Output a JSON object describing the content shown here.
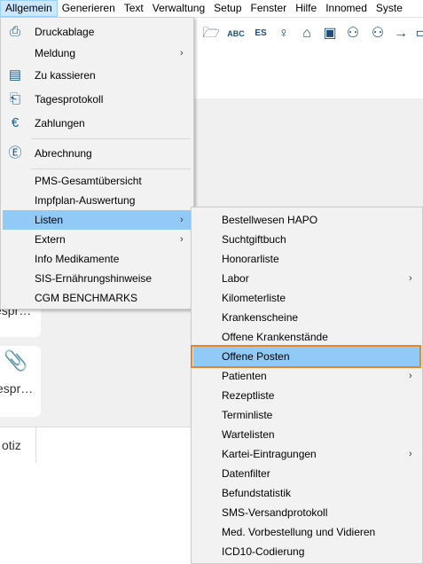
{
  "menubar": {
    "items": [
      "Allgemein",
      "Generieren",
      "Text",
      "Verwaltung",
      "Setup",
      "Fenster",
      "Hilfe",
      "Innomed",
      "Syste"
    ]
  },
  "toolbar": {
    "icons": [
      "folder-c-icon",
      "abc-document-icon",
      "es-document-icon",
      "person-key-icon",
      "house-person-icon",
      "id-card-icon",
      "person-arrows-icon",
      "person-add-icon",
      "person-arrow-icon",
      "clipboard-icon"
    ]
  },
  "background": {
    "card1_text": "espr…",
    "card2_text": "espr…",
    "notiz_label": "otiz"
  },
  "menu_allgemein": {
    "items": [
      {
        "label": "Druckablage",
        "icon": "printer-icon"
      },
      {
        "label": "Meldung",
        "icon": "",
        "submenu": true
      },
      {
        "label": "Zu kassieren",
        "icon": "cash-register-icon"
      },
      {
        "label": "Tagesprotokoll",
        "icon": "document-icon"
      },
      {
        "label": "Zahlungen",
        "icon": "euro-list-icon"
      },
      {
        "label": "Abrechnung",
        "icon": "euro-circle-icon"
      },
      {
        "label": "PMS-Gesamtübersicht",
        "icon": ""
      },
      {
        "label": "Impfplan-Auswertung",
        "icon": ""
      },
      {
        "label": "Listen",
        "icon": "",
        "submenu": true,
        "highlighted": true
      },
      {
        "label": "Extern",
        "icon": "",
        "submenu": true
      },
      {
        "label": "Info Medikamente",
        "icon": ""
      },
      {
        "label": "SIS-Ernährungshinweise",
        "icon": ""
      },
      {
        "label": "CGM BENCHMARKS",
        "icon": ""
      }
    ]
  },
  "menu_listen": {
    "items": [
      {
        "label": "Bestellwesen HAPO"
      },
      {
        "label": "Suchtgiftbuch"
      },
      {
        "label": "Honorarliste"
      },
      {
        "label": "Labor",
        "submenu": true
      },
      {
        "label": "Kilometerliste"
      },
      {
        "label": "Krankenscheine"
      },
      {
        "label": "Offene Krankenstände"
      },
      {
        "label": "Offene Posten",
        "highlighted": true
      },
      {
        "label": "Patienten",
        "submenu": true
      },
      {
        "label": "Rezeptliste"
      },
      {
        "label": "Terminliste"
      },
      {
        "label": "Wartelisten"
      },
      {
        "label": "Kartei-Eintragungen",
        "submenu": true
      },
      {
        "label": "Datenfilter"
      },
      {
        "label": "Befundstatistik"
      },
      {
        "label": "SMS-Versandprotokoll"
      },
      {
        "label": "Med. Vorbestellung und Vidieren"
      },
      {
        "label": "ICD10-Codierung"
      }
    ]
  },
  "colors": {
    "highlight": "#91c9f7",
    "focus_outline": "#e8852a"
  }
}
